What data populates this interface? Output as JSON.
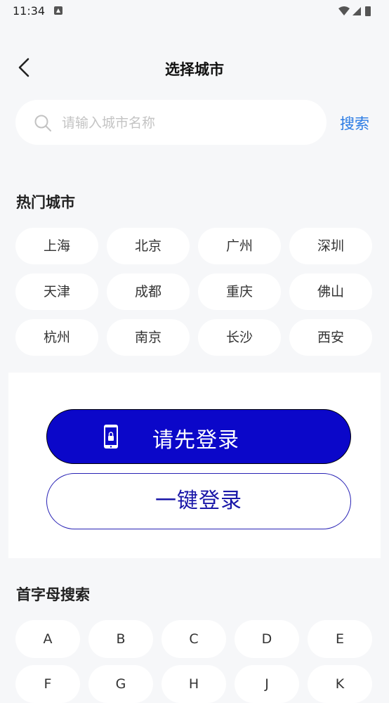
{
  "status_bar": {
    "time": "11:34"
  },
  "header": {
    "title": "选择城市"
  },
  "search": {
    "placeholder": "请输入城市名称",
    "value": "",
    "button_label": "搜索"
  },
  "hot_cities": {
    "title": "热门城市",
    "items": [
      "上海",
      "北京",
      "广州",
      "深圳",
      "天津",
      "成都",
      "重庆",
      "佛山",
      "杭州",
      "南京",
      "长沙",
      "西安"
    ]
  },
  "login_panel": {
    "primary_label": "请先登录",
    "secondary_label": "一键登录"
  },
  "letter_index": {
    "title": "首字母搜索",
    "letters": [
      "A",
      "B",
      "C",
      "D",
      "E",
      "F",
      "G",
      "H",
      "J",
      "K"
    ]
  },
  "colors": {
    "accent_blue": "#2a7be4",
    "login_button": "#0b07c9",
    "onekey_text": "#1a17a8",
    "background": "#f6f7f9"
  },
  "icons": [
    "notification-icon",
    "wifi-icon",
    "signal-icon",
    "battery-icon",
    "back-icon",
    "search-icon",
    "phone-lock-icon"
  ]
}
